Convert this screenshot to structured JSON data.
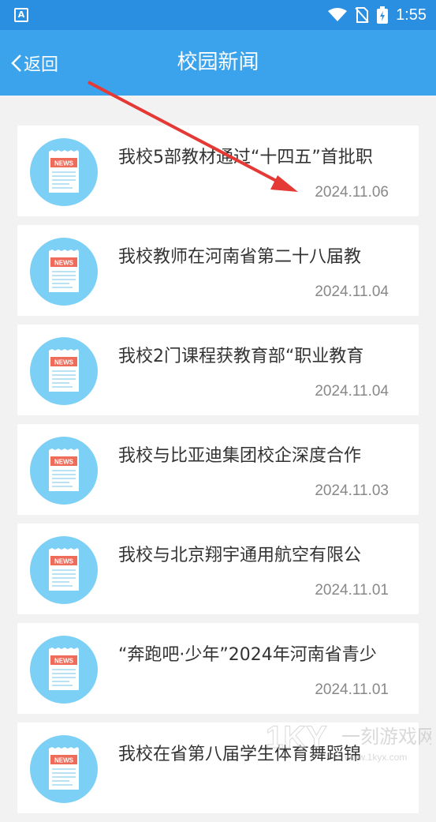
{
  "status_bar": {
    "time": "1:55"
  },
  "header": {
    "back_label": "返回",
    "title": "校园新闻"
  },
  "news": [
    {
      "title": "我校5部教材通过“十四五”首批职",
      "date": "2024.11.06"
    },
    {
      "title": "我校教师在河南省第二十八届教",
      "date": "2024.11.04"
    },
    {
      "title": "我校2门课程获教育部“职业教育",
      "date": "2024.11.04"
    },
    {
      "title": "我校与比亚迪集团校企深度合作",
      "date": "2024.11.03"
    },
    {
      "title": "我校与北京翔宇通用航空有限公",
      "date": "2024.11.01"
    },
    {
      "title": "“奔跑吧·少年”2024年河南省青少",
      "date": "2024.11.01"
    },
    {
      "title": "我校在省第八届学生体育舞蹈锦",
      "date": ""
    }
  ],
  "thumb_label": "NEWS",
  "colors": {
    "header": "#3aa3ec",
    "statusbar": "#2a8fe0",
    "thumb": "#7cd0f5",
    "arrow": "#e53935"
  }
}
